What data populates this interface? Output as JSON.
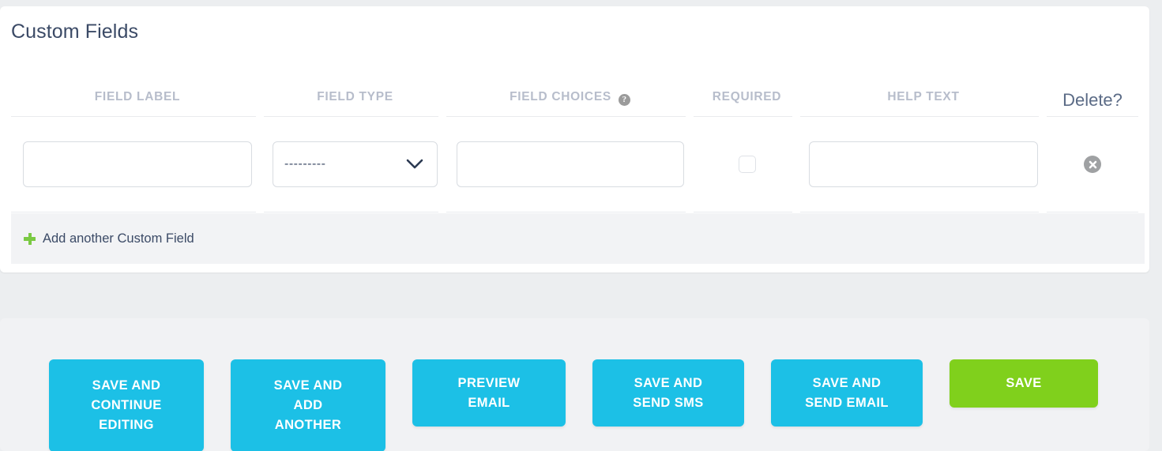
{
  "panel": {
    "title": "Custom Fields"
  },
  "table": {
    "columns": [
      {
        "key": "field_label",
        "label": "FIELD LABEL",
        "has_help": false
      },
      {
        "key": "field_type",
        "label": "FIELD TYPE",
        "has_help": false
      },
      {
        "key": "field_choices",
        "label": "FIELD CHOICES",
        "has_help": true,
        "help_glyph": "?"
      },
      {
        "key": "required",
        "label": "REQUIRED",
        "has_help": false
      },
      {
        "key": "help_text",
        "label": "HELP TEXT",
        "has_help": false
      },
      {
        "key": "delete",
        "label": "Delete?",
        "has_help": false
      }
    ],
    "rows": [
      {
        "field_label": {
          "value": "",
          "placeholder": ""
        },
        "field_type": {
          "selected": "---------",
          "options": [
            "---------"
          ]
        },
        "field_choices": {
          "value": "",
          "placeholder": ""
        },
        "required": {
          "checked": false
        },
        "help_text": {
          "value": "",
          "placeholder": ""
        },
        "delete": {
          "icon": "remove-circle-icon"
        }
      }
    ]
  },
  "add_row": {
    "icon": "plus-icon",
    "label": "Add another Custom Field"
  },
  "actions": {
    "buttons": [
      {
        "key": "save_continue_editing",
        "label": "SAVE AND\nCONTINUE\nEDITING",
        "style": "cyan"
      },
      {
        "key": "save_add_another",
        "label": "SAVE AND\nADD\nANOTHER",
        "style": "cyan"
      },
      {
        "key": "preview_email",
        "label": "PREVIEW\nEMAIL",
        "style": "cyan"
      },
      {
        "key": "save_send_sms",
        "label": "SAVE AND\nSEND SMS",
        "style": "cyan"
      },
      {
        "key": "save_send_email",
        "label": "SAVE AND\nSEND EMAIL",
        "style": "cyan"
      },
      {
        "key": "save",
        "label": "SAVE",
        "style": "green"
      }
    ]
  },
  "colors": {
    "accent_cyan": "#1cc0e6",
    "accent_green": "#80d01c",
    "heading_text": "#3b4a66",
    "column_header_text": "#b7bdcb",
    "panel_bg": "#ffffff",
    "page_bg": "#eceef0",
    "action_bar_bg": "#f1f2f4",
    "add_row_bg": "#f2f3f5",
    "border": "#d8dce1",
    "help_badge_bg": "#9b9b9b",
    "delete_icon_bg": "#9fa1a3"
  }
}
